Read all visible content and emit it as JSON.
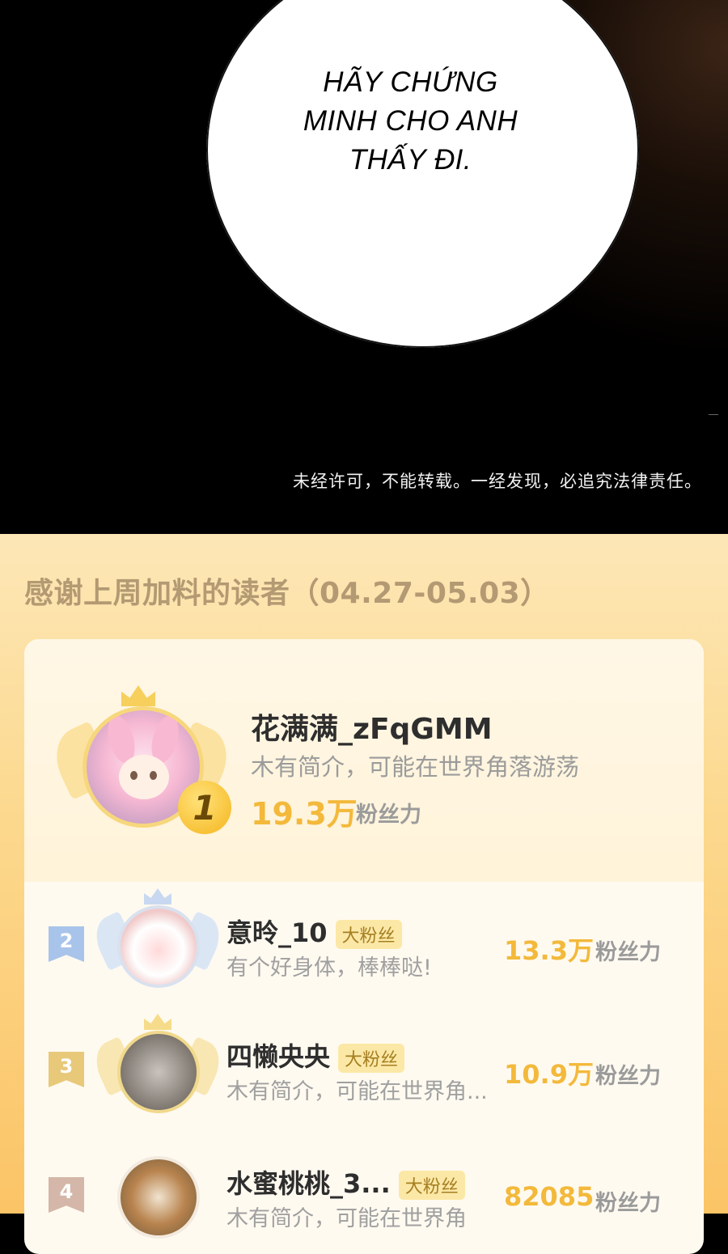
{
  "comic": {
    "bubble_lines": [
      "HÃY CHỨNG",
      "MINH CHO ANH",
      "THẤY ĐI."
    ],
    "copyright": "未经许可，不能转载。一经发现，必追究法律责任。"
  },
  "leaderboard": {
    "title": "感谢上周加料的读者（04.27-05.03）",
    "top": {
      "rank": "1",
      "name": "花满满_zFqGMM",
      "bio": "木有简介，可能在世界角落游荡",
      "score": "19.3万",
      "score_label": "粉丝力"
    },
    "rows": [
      {
        "rank": "2",
        "name": "意昤_10",
        "badge": "大粉丝",
        "bio": "有个好身体，棒棒哒!",
        "score": "13.3万",
        "score_label": "粉丝力"
      },
      {
        "rank": "3",
        "name": "四懒央央",
        "badge": "大粉丝",
        "bio": "木有简介，可能在世界角...",
        "score": "10.9万",
        "score_label": "粉丝力"
      },
      {
        "rank": "4",
        "name": "水蜜桃桃_3...",
        "badge": "大粉丝",
        "bio": "木有简介，可能在世界角",
        "score": "82085",
        "score_label": "粉丝力"
      }
    ]
  },
  "colors": {
    "gold": "#f3b93b",
    "rank2": "#a9c4ea",
    "rank3": "#e8c97a",
    "rank4": "#d4b7a8"
  }
}
